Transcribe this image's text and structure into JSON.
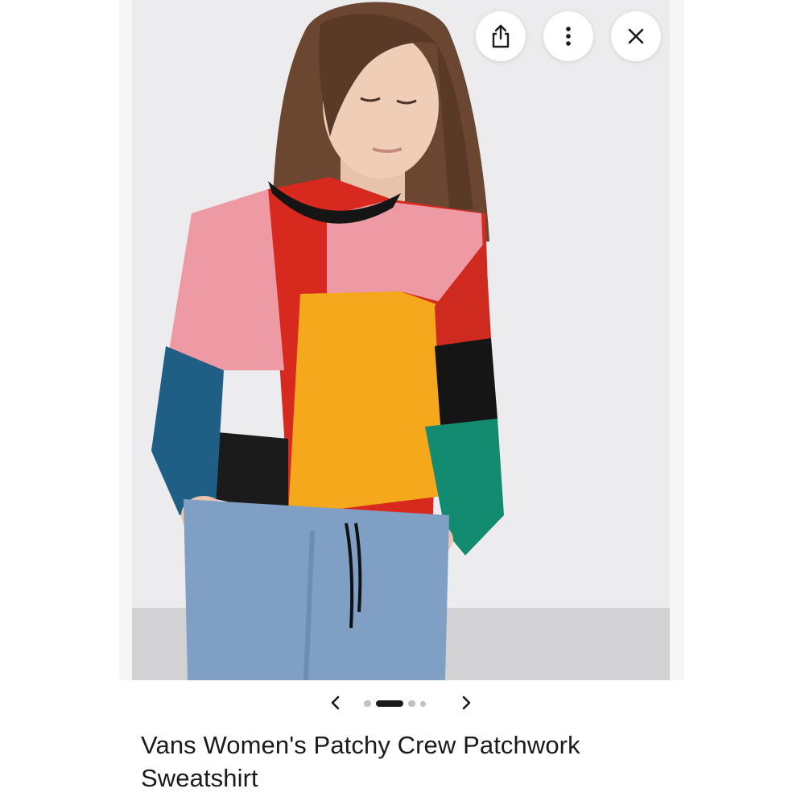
{
  "product": {
    "title": "Vans Women's Patchy Crew Patchwork Sweatshirt"
  },
  "toolbar": {
    "actions": [
      {
        "name": "share-button",
        "icon": "share-icon"
      },
      {
        "name": "more-options-button",
        "icon": "more-vertical-icon"
      },
      {
        "name": "close-button",
        "icon": "close-icon"
      }
    ]
  },
  "carousel": {
    "image_count": 4,
    "active_index": 1,
    "prev_icon": "chevron-left-icon",
    "next_icon": "chevron-right-icon"
  },
  "colors": {
    "active_dot": "#1a1a1a",
    "inactive_dot": "#c0c0c0",
    "background": "#ffffff"
  }
}
